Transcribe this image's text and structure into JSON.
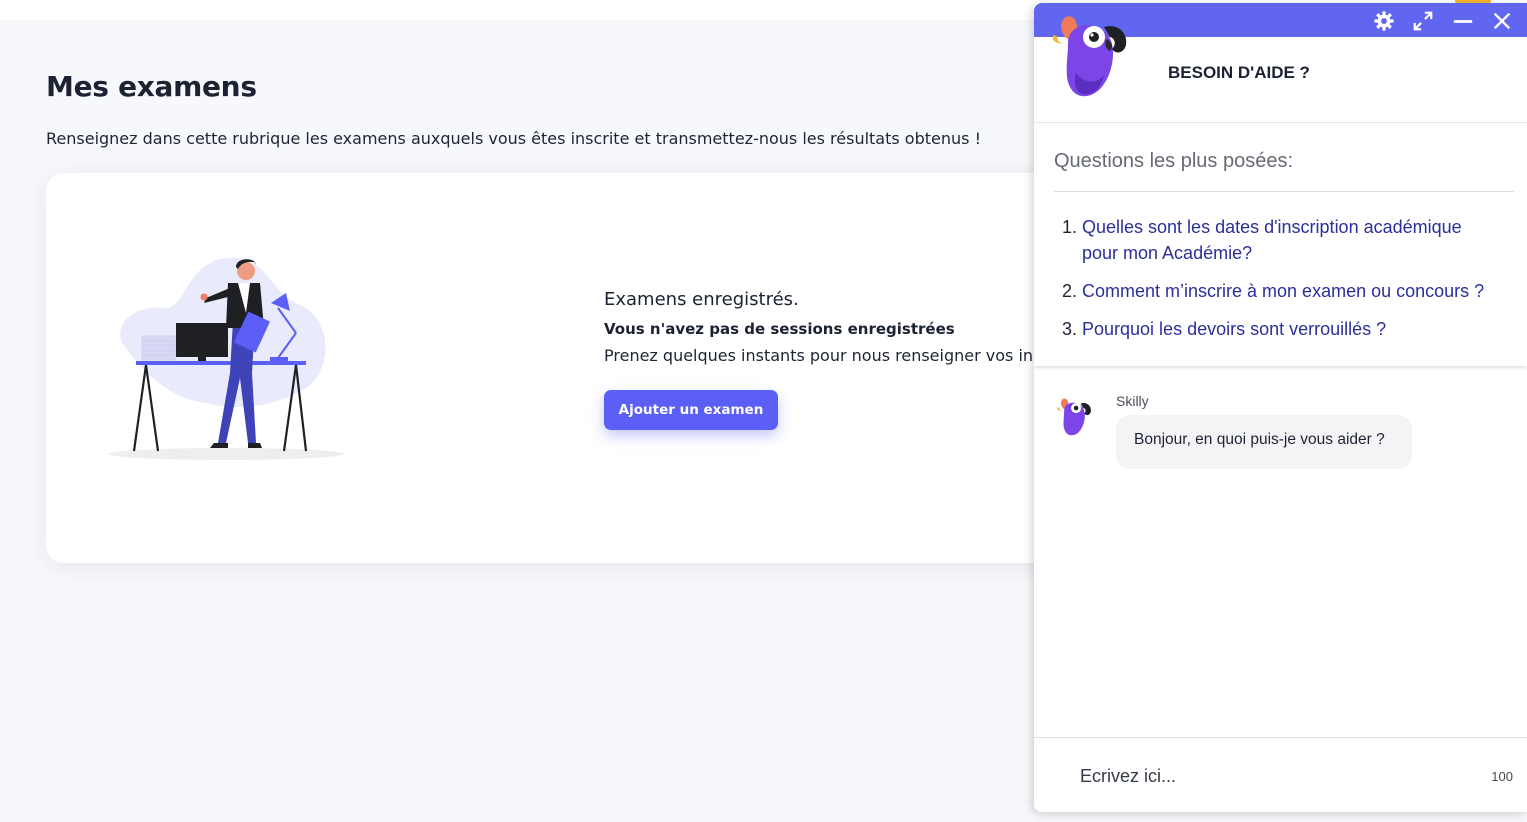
{
  "page": {
    "title": "Mes examens",
    "subtitle": "Renseignez dans cette rubrique les examens auxquels vous êtes inscrite et transmettez-nous les résultats obtenus !"
  },
  "card": {
    "empty_title": "Examens enregistrés.",
    "empty_subtitle": "Vous n'avez pas de sessions enregistrées",
    "empty_text": "Prenez quelques instants pour nous renseigner vos in",
    "add_button": "Ajouter un examen"
  },
  "chat": {
    "title": "BESOIN D'AIDE ?",
    "controls": {
      "settings": "gear-icon",
      "expand": "expand-icon",
      "minimize": "minimize-icon",
      "close": "close-icon"
    },
    "faq_heading": "Questions les plus posées:",
    "faq": [
      {
        "num": "1.",
        "text": "Quelles sont les dates d'inscription académique pour mon Académie?"
      },
      {
        "num": "2.",
        "text": "Comment m’inscrire à mon examen ou concours ?"
      },
      {
        "num": "3.",
        "text": "Pourquoi les devoirs sont verrouillés ?"
      }
    ],
    "sender": "Skilly",
    "message": "Bonjour, en quoi puis-je vous aider ?",
    "input_placeholder": "Ecrivez ici...",
    "char_count": "100"
  },
  "colors": {
    "accent": "#5b5ff5",
    "chat_bar": "#6166f0",
    "faq_link": "#2a2f9c",
    "background": "#f7f8fb"
  }
}
